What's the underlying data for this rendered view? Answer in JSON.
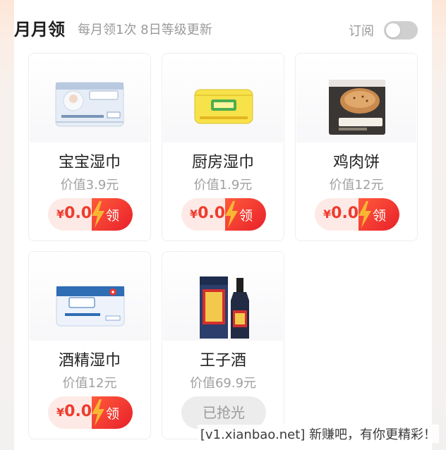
{
  "header": {
    "title": "月月领",
    "subtitle": "每月领1次 8日等级更新",
    "subscribe_label": "订阅",
    "subscribe_on": false
  },
  "items": [
    {
      "name": "宝宝湿巾",
      "value": "价值3.9元",
      "price_symbol": "¥",
      "price": "0.01",
      "action": "领",
      "status": "available",
      "icon": "baby-wipes-product-icon"
    },
    {
      "name": "厨房湿巾",
      "value": "价值1.9元",
      "price_symbol": "¥",
      "price": "0.01",
      "action": "领",
      "status": "available",
      "icon": "kitchen-wipes-product-icon"
    },
    {
      "name": "鸡肉饼",
      "value": "价值12元",
      "price_symbol": "¥",
      "price": "0.01",
      "action": "领",
      "status": "available",
      "icon": "chicken-pie-product-icon"
    },
    {
      "name": "酒精湿巾",
      "value": "价值12元",
      "price_symbol": "¥",
      "price": "0.01",
      "action": "领",
      "status": "available",
      "icon": "alcohol-wipes-product-icon"
    },
    {
      "name": "王子酒",
      "value": "价值69.9元",
      "status": "sold_out",
      "soldout_label": "已抢光",
      "icon": "liquor-bottle-product-icon"
    }
  ],
  "watermark": "[v1.xianbao.net] 新赚吧，有你更精彩！",
  "colors": {
    "accent_red": "#ef3b2d",
    "claim_bg": "#fdeae6",
    "bolt_yellow": "#f7b733",
    "toggle_off": "#cfcfcf"
  }
}
